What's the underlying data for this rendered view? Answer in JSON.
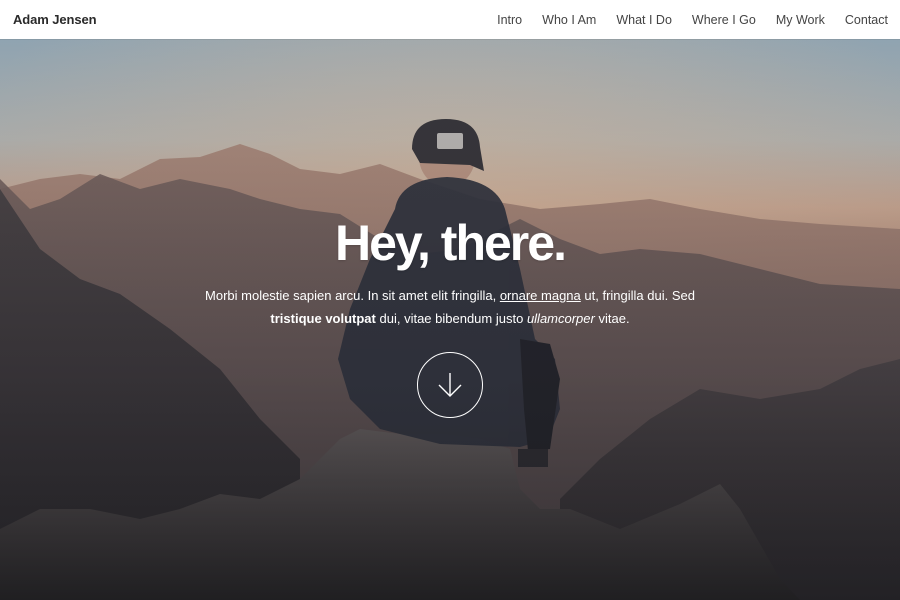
{
  "header": {
    "brand": "Adam Jensen",
    "nav": [
      {
        "label": "Intro"
      },
      {
        "label": "Who I Am"
      },
      {
        "label": "What I Do"
      },
      {
        "label": "Where I Go"
      },
      {
        "label": "My Work"
      },
      {
        "label": "Contact"
      }
    ]
  },
  "hero": {
    "headline": "Hey, there.",
    "text_1": "Morbi molestie sapien arcu. In sit amet elit fringilla,",
    "link": "ornare magna",
    "text_2": "ut, fringilla dui. Sed",
    "bold": "tristique volutpat",
    "text_3": "dui, vitae bibendum justo",
    "italic": "ullamcorper",
    "text_4": "vitae.",
    "scroll_icon": "arrow-down-icon"
  },
  "colors": {
    "header_bg": "#ffffff",
    "brand_text": "#2a2a2a",
    "nav_text": "#444444",
    "hero_text": "#ffffff"
  }
}
